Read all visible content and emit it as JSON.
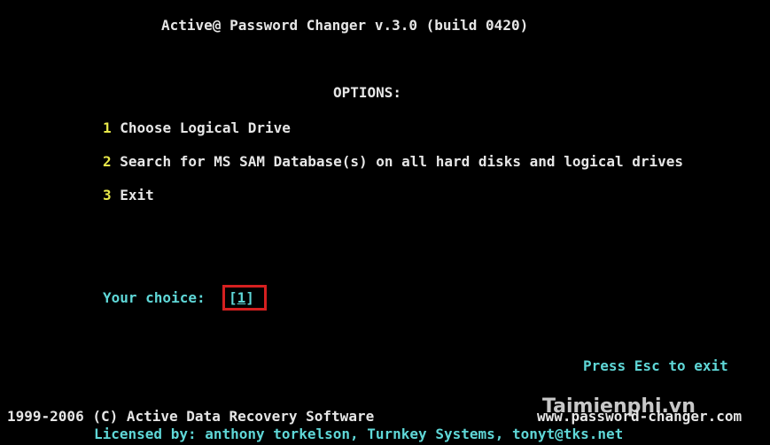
{
  "header": {
    "title": "Active@ Password Changer v.3.0 (build 0420)"
  },
  "options": {
    "heading": "OPTIONS:",
    "items": [
      {
        "number": "1",
        "label": "Choose Logical Drive"
      },
      {
        "number": "2",
        "label": "Search for MS SAM Database(s) on all hard disks and logical drives"
      },
      {
        "number": "3",
        "label": "Exit"
      }
    ]
  },
  "prompt": {
    "label": "Your choice:",
    "open_bracket": "[",
    "value": "1",
    "close_bracket": "]"
  },
  "hint": {
    "exit": "Press Esc to exit"
  },
  "footer": {
    "copyright": "1999-2006 (C) Active Data Recovery Software",
    "url": "www.password-changer.com",
    "license": "Licensed by: anthony torkelson, Turnkey Systems, tonyt@tks.net"
  },
  "watermark": {
    "text": "Taimienphi.vn"
  },
  "colors": {
    "background": "#000000",
    "text": "#E6E6E6",
    "menu_number": "#E8E84A",
    "accent": "#5FD7D7",
    "highlight_box": "#D62020"
  }
}
